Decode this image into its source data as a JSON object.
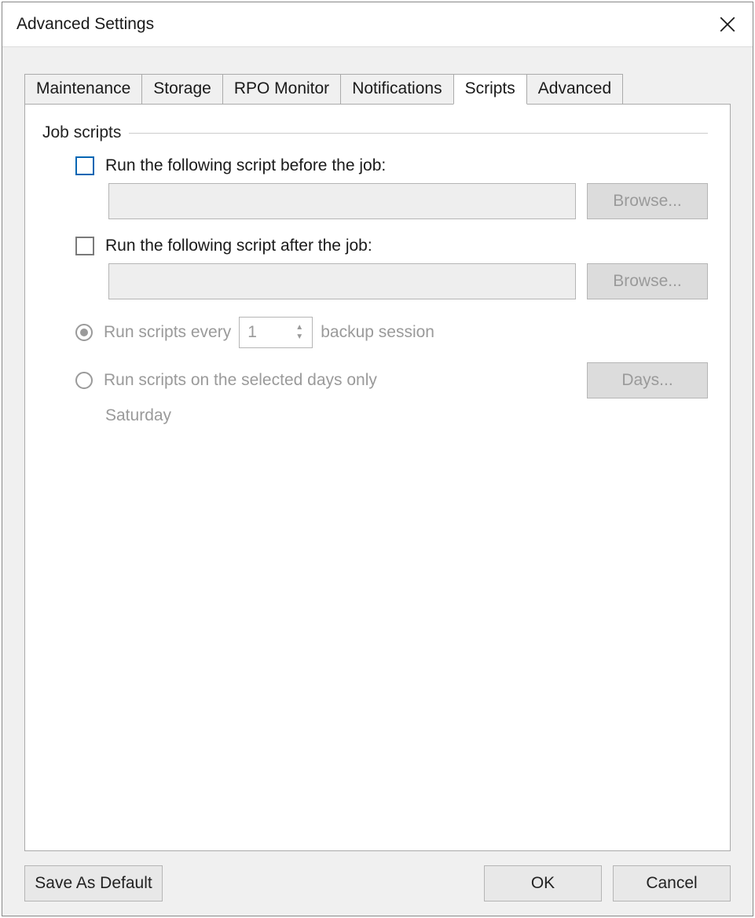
{
  "window": {
    "title": "Advanced Settings"
  },
  "tabs": [
    {
      "label": "Maintenance"
    },
    {
      "label": "Storage"
    },
    {
      "label": "RPO Monitor"
    },
    {
      "label": "Notifications"
    },
    {
      "label": "Scripts"
    },
    {
      "label": "Advanced"
    }
  ],
  "active_tab_index": 4,
  "group": {
    "label": "Job scripts"
  },
  "before": {
    "checkbox_label": "Run the following script before the job:",
    "path": "",
    "browse": "Browse..."
  },
  "after": {
    "checkbox_label": "Run the following script after the job:",
    "path": "",
    "browse": "Browse..."
  },
  "schedule": {
    "every_prefix": "Run scripts every",
    "every_value": "1",
    "every_suffix": "backup session",
    "days_label": "Run scripts on the selected days only",
    "days_button": "Days...",
    "selected_days": "Saturday"
  },
  "footer": {
    "save_default": "Save As Default",
    "ok": "OK",
    "cancel": "Cancel"
  }
}
